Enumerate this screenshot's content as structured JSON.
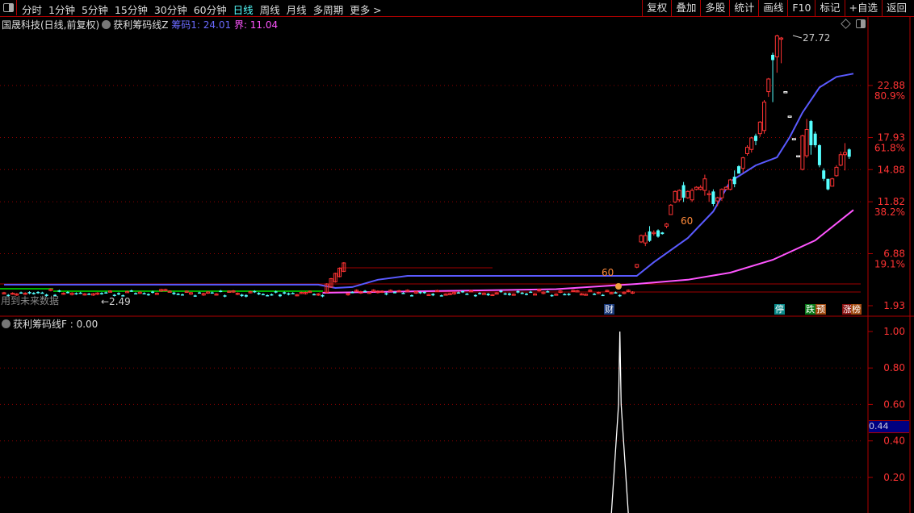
{
  "toolbar": {
    "periods": [
      "分时",
      "1分钟",
      "5分钟",
      "15分钟",
      "30分钟",
      "60分钟",
      "日线",
      "周线",
      "月线",
      "多周期",
      "更多 >"
    ],
    "active_period": "日线",
    "buttons": [
      "复权",
      "叠加",
      "多股",
      "统计",
      "画线",
      "F10",
      "标记",
      "+自选",
      "返回"
    ]
  },
  "main_title": {
    "stock": "国晟科技(日线,前复权)",
    "indicator": "获利筹码线Z",
    "chip_label": "筹码1: 24.01",
    "bound_label": "界: 11.04"
  },
  "sub_title": {
    "indicator": "获利筹码线F",
    "value": ": 0.00"
  },
  "annotations": {
    "future_data": "用到未来数据",
    "low_marker": "←2.49",
    "high_marker": "27.72",
    "sixty_1": "60",
    "sixty_2": "60"
  },
  "badges": [
    {
      "text": "财",
      "bg": "#1a3a7a"
    },
    {
      "text": "停",
      "bg": "#0a8a8a"
    },
    {
      "text": "跌",
      "bg": "#0a7a1a"
    },
    {
      "text": "预",
      "bg": "#a04a10"
    },
    {
      "text": "涨",
      "bg": "#8a1010"
    },
    {
      "text": "榜",
      "bg": "#a04a10"
    }
  ],
  "colors": {
    "up": "#ff3333",
    "down": "#55ffff",
    "chip": "#5a5aff",
    "bound": "#ff55ff",
    "axis": "#b00000",
    "grid": "#8b0000"
  },
  "chart_data": {
    "type": "candlestick",
    "main_axis": {
      "ticks": [
        {
          "price": "22.88",
          "pct": "80.9%"
        },
        {
          "price": "17.93",
          "pct": "61.8%"
        },
        {
          "price": "14.88",
          "pct": ""
        },
        {
          "price": "11.82",
          "pct": "38.2%"
        },
        {
          "price": "6.88",
          "pct": "19.1%"
        },
        {
          "price": "1.93",
          "pct": ""
        }
      ],
      "ylim": [
        1.93,
        22.88
      ]
    },
    "rally_candles_start_index": 149,
    "rally_candles": [
      [
        5.6,
        5.9,
        5.5,
        5.85
      ],
      [
        8.0,
        8.7,
        7.9,
        8.6
      ],
      [
        7.9,
        8.9,
        7.6,
        8.6
      ],
      [
        9.0,
        9.5,
        8.0,
        8.1
      ],
      [
        8.8,
        9.1,
        8.6,
        8.9
      ],
      [
        9.1,
        9.2,
        8.4,
        8.5
      ],
      [
        8.9,
        8.95,
        8.7,
        8.75
      ],
      [
        9.5,
        9.8,
        9.3,
        9.7
      ],
      [
        10.6,
        11.6,
        10.6,
        11.5
      ],
      [
        11.8,
        12.9,
        11.7,
        12.8
      ],
      [
        12.0,
        13.0,
        11.8,
        12.9
      ],
      [
        13.4,
        13.7,
        11.8,
        12.2
      ],
      [
        12.2,
        12.9,
        12.1,
        12.8
      ],
      [
        12.0,
        13.1,
        11.8,
        12.9
      ],
      [
        13.0,
        13.3,
        12.9,
        13.2
      ],
      [
        13.0,
        13.4,
        12.9,
        13.2
      ],
      [
        12.9,
        14.4,
        12.4,
        14.0
      ],
      [
        12.5,
        12.9,
        11.8,
        12.6
      ],
      [
        12.8,
        13.0,
        11.4,
        11.6
      ],
      [
        11.9,
        12.3,
        11.4,
        12.2
      ],
      [
        12.2,
        13.1,
        11.9,
        13.0
      ],
      [
        13.0,
        13.3,
        12.9,
        13.2
      ],
      [
        13.0,
        14.0,
        12.9,
        13.9
      ],
      [
        14.2,
        14.8,
        13.2,
        13.5
      ],
      [
        15.2,
        15.3,
        14.5,
        14.5
      ],
      [
        15.0,
        16.1,
        14.6,
        16.0
      ],
      [
        16.4,
        17.2,
        16.2,
        17.0
      ],
      [
        16.8,
        18.0,
        16.5,
        17.9
      ],
      [
        18.1,
        18.3,
        17.2,
        17.6
      ],
      [
        18.3,
        19.5,
        18.0,
        19.4
      ],
      [
        18.6,
        21.5,
        18.3,
        21.3
      ],
      [
        22.3,
        23.6,
        21.8,
        23.5
      ],
      [
        25.8,
        26.0,
        21.3,
        25.3
      ],
      [
        25.6,
        27.72,
        24.1,
        27.6
      ],
      [
        27.4,
        27.5,
        25.0,
        27.4
      ],
      [
        22.3,
        22.3,
        22.3,
        22.3
      ],
      [
        19.97,
        19.97,
        19.97,
        19.97
      ],
      [
        17.83,
        17.83,
        17.83,
        17.83
      ],
      [
        16.2,
        16.2,
        16.2,
        16.2
      ],
      [
        14.9,
        18.2,
        14.8,
        18.1
      ],
      [
        16.2,
        19.7,
        16.0,
        18.7
      ],
      [
        19.5,
        19.6,
        16.3,
        17.2
      ],
      [
        18.3,
        18.5,
        17.0,
        17.2
      ],
      [
        17.2,
        17.3,
        15.1,
        15.3
      ],
      [
        14.8,
        15.0,
        13.8,
        14.0
      ],
      [
        14.0,
        14.0,
        12.9,
        13.0
      ],
      [
        13.3,
        14.1,
        13.3,
        14.0
      ],
      [
        14.3,
        15.3,
        14.2,
        15.1
      ],
      [
        15.3,
        16.6,
        15.2,
        16.3
      ],
      [
        16.3,
        17.4,
        14.8,
        16.5
      ],
      [
        16.8,
        16.9,
        15.9,
        16.1
      ]
    ],
    "series": [
      {
        "name": "筹码1",
        "points": [
          [
            0,
            3.93
          ],
          [
            74,
            3.93
          ],
          [
            78,
            3.62
          ],
          [
            82,
            3.7
          ],
          [
            88,
            4.4
          ],
          [
            95,
            4.77
          ],
          [
            149,
            4.77
          ],
          [
            153,
            6.07
          ],
          [
            161,
            8.37
          ],
          [
            167,
            10.9
          ],
          [
            171,
            13.75
          ],
          [
            177,
            15.28
          ],
          [
            182,
            16.05
          ],
          [
            185,
            17.97
          ],
          [
            188,
            20.3
          ],
          [
            192,
            22.7
          ],
          [
            196,
            23.7
          ],
          [
            200,
            24.01
          ]
        ]
      },
      {
        "name": "界",
        "points": [
          [
            75,
            3.16
          ],
          [
            130,
            3.5
          ],
          [
            149,
            4.0
          ],
          [
            161,
            4.4
          ],
          [
            171,
            5.08
          ],
          [
            181,
            6.3
          ],
          [
            191,
            8.15
          ],
          [
            200,
            11.04
          ]
        ]
      }
    ],
    "sub_axis": {
      "ticks": [
        "1.00",
        "0.80",
        "0.60",
        "0.40",
        "0.20"
      ],
      "ylim": [
        0,
        1.0
      ],
      "current": "0.44"
    },
    "sub_series": {
      "name": "获利筹码线F",
      "points": [
        [
          143,
          0
        ],
        [
          144.7,
          0.6
        ],
        [
          145,
          1.0
        ],
        [
          145.3,
          0.6
        ],
        [
          147,
          0
        ]
      ]
    }
  }
}
